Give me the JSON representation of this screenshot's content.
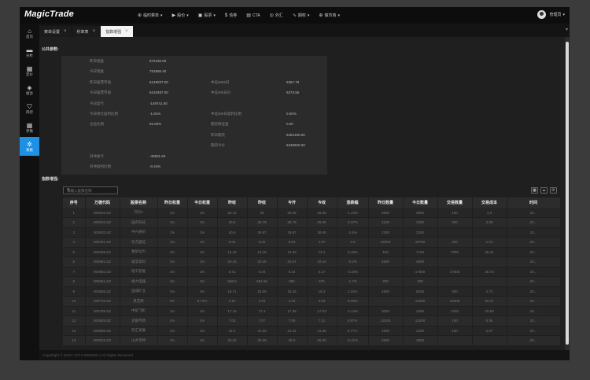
{
  "app": {
    "logo": "MagicTrade"
  },
  "topnav": [
    {
      "icon": "⊕",
      "label": "临时菜单",
      "caret": "▾"
    },
    {
      "icon": "▶",
      "label": "股价",
      "caret": "▾"
    },
    {
      "icon": "▣",
      "label": "股票",
      "caret": "▾"
    },
    {
      "icon": "$",
      "label": "债券",
      "caret": ""
    },
    {
      "icon": "▤",
      "label": "CTA",
      "caret": ""
    },
    {
      "icon": "◎",
      "label": "外汇",
      "caret": ""
    },
    {
      "icon": "∿",
      "label": "期权",
      "caret": "▾"
    },
    {
      "icon": "⊕",
      "label": "做市商",
      "caret": "▾"
    }
  ],
  "user": {
    "name": "管理员",
    "caret": "▾"
  },
  "sidebar": [
    {
      "icon": "⌂",
      "label": "首页"
    },
    {
      "icon": "▬",
      "label": "分析"
    },
    {
      "icon": "▦",
      "label": "定价"
    },
    {
      "icon": "◈",
      "label": "组合"
    },
    {
      "icon": "⛉",
      "label": "风控"
    },
    {
      "icon": "▦",
      "label": "参数"
    },
    {
      "icon": "✲",
      "label": "系统",
      "active": true
    }
  ],
  "tabs": [
    {
      "label": "菜单设置"
    },
    {
      "label": "利率表"
    },
    {
      "label": "指数增强",
      "active": true
    }
  ],
  "sections": {
    "public_params": "公共参数:",
    "index_enhance": "指数增强:"
  },
  "params": [
    [
      "昨日现金",
      "972160.00",
      "",
      ""
    ],
    [
      "今日现金",
      "751586.40",
      "",
      ""
    ],
    [
      "昨日股票市值",
      "6149037.00",
      "中证5000日",
      "6357.79"
    ],
    [
      "今日股票市值",
      "6219487.00",
      "中证500日价",
      "6273.55"
    ],
    [
      "今日盈亏",
      "-149741.60",
      "",
      ""
    ],
    [
      "今日持仓盈利比例",
      "-1.91%",
      "中证500日盈利比例",
      "0.00%"
    ],
    [
      "仓位比例",
      "92.00%",
      "期货保证金",
      "0.00"
    ],
    [
      "",
      "",
      "昨日期货",
      "6452160.00"
    ],
    [
      "",
      "",
      "期货今价",
      "6345920.00"
    ],
    [
      "对冲盈亏",
      "-40501.60",
      "",
      ""
    ],
    [
      "对冲盈利比例",
      "-0.44%",
      "",
      ""
    ]
  ],
  "search": {
    "placeholder": "请输入股票名称"
  },
  "table": {
    "headers": [
      "序号",
      "万德代码",
      "股票名称",
      "昨日权重",
      "今日权重",
      "昨收",
      "昨收",
      "今开",
      "今收",
      "涨跌幅",
      "昨日数量",
      "今日数量",
      "交易数量",
      "交易成本",
      "时间"
    ],
    "rows": [
      [
        "1",
        "000002.SZ",
        "万科A",
        "1%",
        "1%",
        "25.13",
        "26",
        "25.55",
        "25.58",
        "-1.23%",
        "3500",
        "3600",
        "100",
        "1.3",
        "20..."
      ],
      [
        "2",
        "000004.SZ",
        "国农科技",
        "1%",
        "1%",
        "29.5",
        "29.79",
        "29.79",
        "29.06",
        "-2.97%",
        "3100",
        "3300",
        "200",
        "2.08",
        "20..."
      ],
      [
        "3",
        "000003.SZ",
        "中兴通讯",
        "1%",
        "1%",
        "40.6",
        "39.87",
        "39.87",
        "38.85",
        "-2.6%",
        "2300",
        "2300",
        "",
        "",
        "20..."
      ],
      [
        "4",
        "000301.SZ",
        "东方盛虹",
        "1%",
        "1%",
        "5.04",
        "5.02",
        "5.04",
        "4.97",
        "-1%",
        "16000",
        "18700",
        "400",
        "1.01",
        "20..."
      ],
      [
        "5",
        "000338.SZ",
        "潍柴动力",
        "1%",
        "1%",
        "13.42",
        "13.18",
        "13.20",
        "13.1",
        "-0.48%",
        "100",
        "7100",
        "7000",
        "45.41",
        "20..."
      ],
      [
        "6",
        "000581.SZ",
        "威孚高科",
        "1%",
        "1%",
        "20.16",
        "20.46",
        "20.57",
        "20.44",
        "-0.2%",
        "4600",
        "4600",
        "",
        "",
        "20..."
      ],
      [
        "7",
        "000584.SZ",
        "哈工智能",
        "1%",
        "1%",
        "5.41",
        "5.34",
        "5.34",
        "5.17",
        "-3.18%",
        "",
        "17500",
        "17500",
        "46.73",
        "20..."
      ],
      [
        "8",
        "000651.SZ",
        "格力电器",
        "1%",
        "1%",
        "586.6",
        "584.66",
        "585",
        "575",
        "-1.7%",
        "200",
        "200",
        "",
        "",
        "20..."
      ],
      [
        "9",
        "000688.SZ",
        "国城矿业",
        "1%",
        "1%",
        "18.71",
        "18.09",
        "18.15",
        "18.3",
        "1.22%",
        "4900",
        "6200",
        "300",
        "2.72",
        "20..."
      ],
      [
        "10",
        "000716.SZ",
        "黑芝麻",
        "0%",
        "8.74%",
        "4.15",
        "4.23",
        "4.23",
        "3.94",
        "-6.86%",
        "",
        "16300",
        "16300",
        "34.47",
        "20..."
      ],
      [
        "11",
        "000768.SZ",
        "中航飞机",
        "1%",
        "1%",
        "17.15",
        "17.4",
        "17.36",
        "17.03",
        "-2.13%",
        "3000",
        "3400",
        "2400",
        "20.60",
        "20..."
      ],
      [
        "12",
        "000825.SZ",
        "太钢不锈",
        "1%",
        "1%",
        "7.03",
        "7.07",
        "7.09",
        "7.11",
        "0.57%",
        "13100",
        "13200",
        "100",
        "0.36",
        "20..."
      ],
      [
        "13",
        "000895.SZ",
        "双汇发展",
        "1%",
        "1%",
        "42.2",
        "41.56",
        "41.41",
        "41.88",
        "0.77%",
        "2200",
        "2300",
        "100",
        "2.07",
        "20..."
      ],
      [
        "14",
        "000915.SZ",
        "山大华特",
        "1%",
        "1%",
        "25.62",
        "25.66",
        "25.6",
        "25.55",
        "-0.41%",
        "3500",
        "3600",
        "",
        "",
        "20..."
      ]
    ]
  },
  "footer": {
    "copyright": "CopyRight © 2019 / ICP 0.0000000-1 All Rights Reserved"
  }
}
